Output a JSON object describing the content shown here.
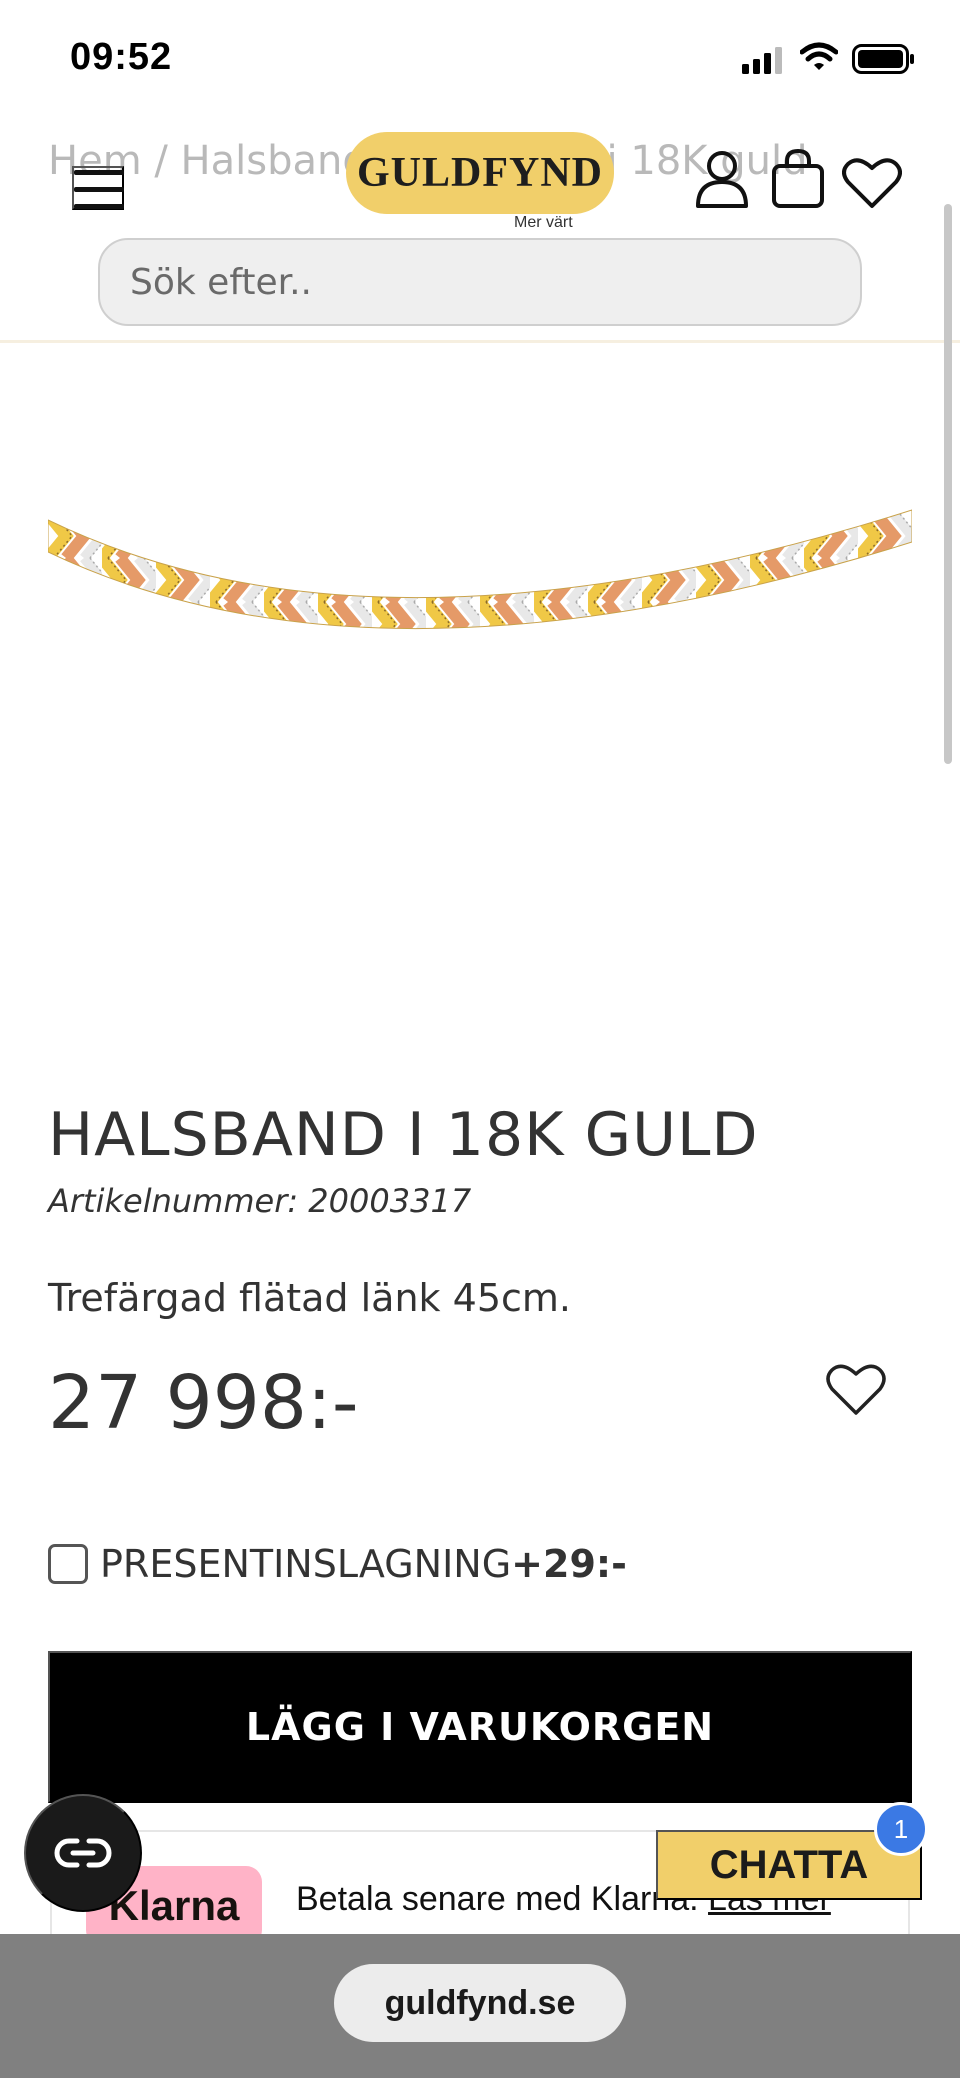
{
  "status_bar": {
    "time": "09:52"
  },
  "header": {
    "breadcrumb": "Hem / Halsband / Halsband i 18K guld",
    "logo_text": "GULDFYND",
    "logo_tagline": "Mer värt",
    "search_placeholder": "Sök efter.."
  },
  "product": {
    "title": "HALSBAND I 18K GULD",
    "article_number": "Artikelnummer: 20003317",
    "description": "Trefärgad flätad länk 45cm.",
    "price": "27 998:-",
    "gift_wrap": {
      "label": "PRESENTINSLAGNING",
      "price": "+29:-",
      "checked": false
    },
    "add_to_cart": "LÄGG I VARUKORGEN"
  },
  "klarna": {
    "logo": "Klarna",
    "text": "Betala senare med Klarna.",
    "link": "Läs mer"
  },
  "chat": {
    "label": "CHATTA",
    "badge": "1"
  },
  "browser": {
    "url": "guldfynd.se"
  },
  "colors": {
    "brand_gold": "#f1cf6a",
    "klarna_pink": "#ffb3c7",
    "chat_badge": "#3b79e4",
    "cart_button": "#000000"
  }
}
